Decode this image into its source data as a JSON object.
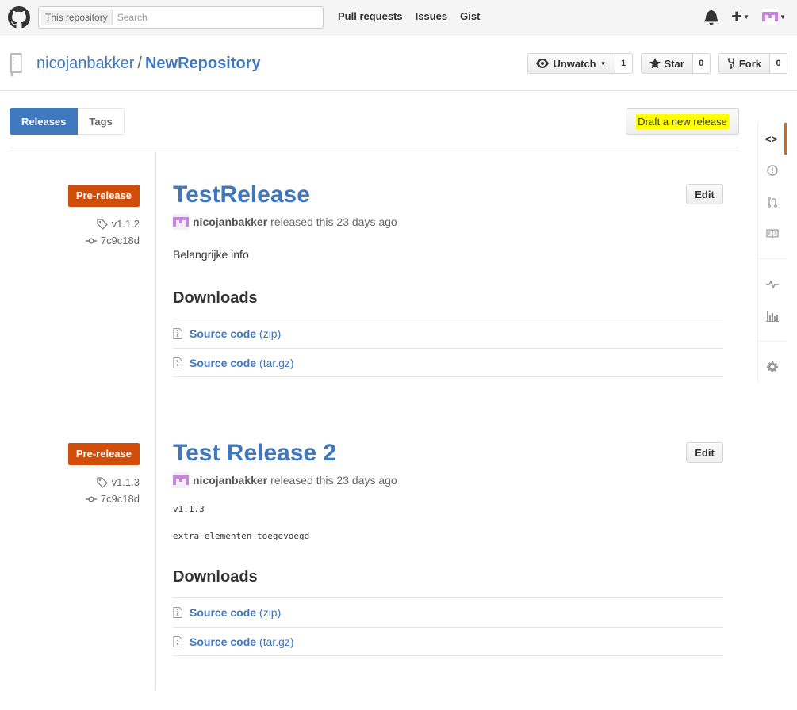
{
  "header": {
    "search_scope": "This repository",
    "search_placeholder": "Search",
    "nav": [
      "Pull requests",
      "Issues",
      "Gist"
    ]
  },
  "repo": {
    "owner": "nicojanbakker",
    "separator": "/",
    "name": "NewRepository",
    "watch_label": "Unwatch",
    "watch_count": "1",
    "star_label": "Star",
    "star_count": "0",
    "fork_label": "Fork",
    "fork_count": "0"
  },
  "subnav": {
    "releases": "Releases",
    "tags": "Tags",
    "draft": "Draft a new release"
  },
  "colors": {
    "link": "#4078c0",
    "prerelease": "#d14d09",
    "highlight": "#ffff00",
    "sidebar_selected": "#d26911"
  },
  "releases": [
    {
      "label": "Pre-release",
      "tag": "v1.1.2",
      "commit": "7c9c18d",
      "title": "TestRelease",
      "edit": "Edit",
      "author": "nicojanbakker",
      "released": "released this 23 days ago",
      "body": "Belangrijke info",
      "downloads_title": "Downloads",
      "downloads": [
        {
          "name": "Source code",
          "format": "(zip)"
        },
        {
          "name": "Source code",
          "format": "(tar.gz)"
        }
      ]
    },
    {
      "label": "Pre-release",
      "tag": "v1.1.3",
      "commit": "7c9c18d",
      "title": "Test Release 2",
      "edit": "Edit",
      "author": "nicojanbakker",
      "released": "released this 23 days ago",
      "body_lines": [
        "v1.1.3",
        "extra elementen toegevoegd"
      ],
      "downloads_title": "Downloads",
      "downloads": [
        {
          "name": "Source code",
          "format": "(zip)"
        },
        {
          "name": "Source code",
          "format": "(tar.gz)"
        }
      ]
    }
  ]
}
